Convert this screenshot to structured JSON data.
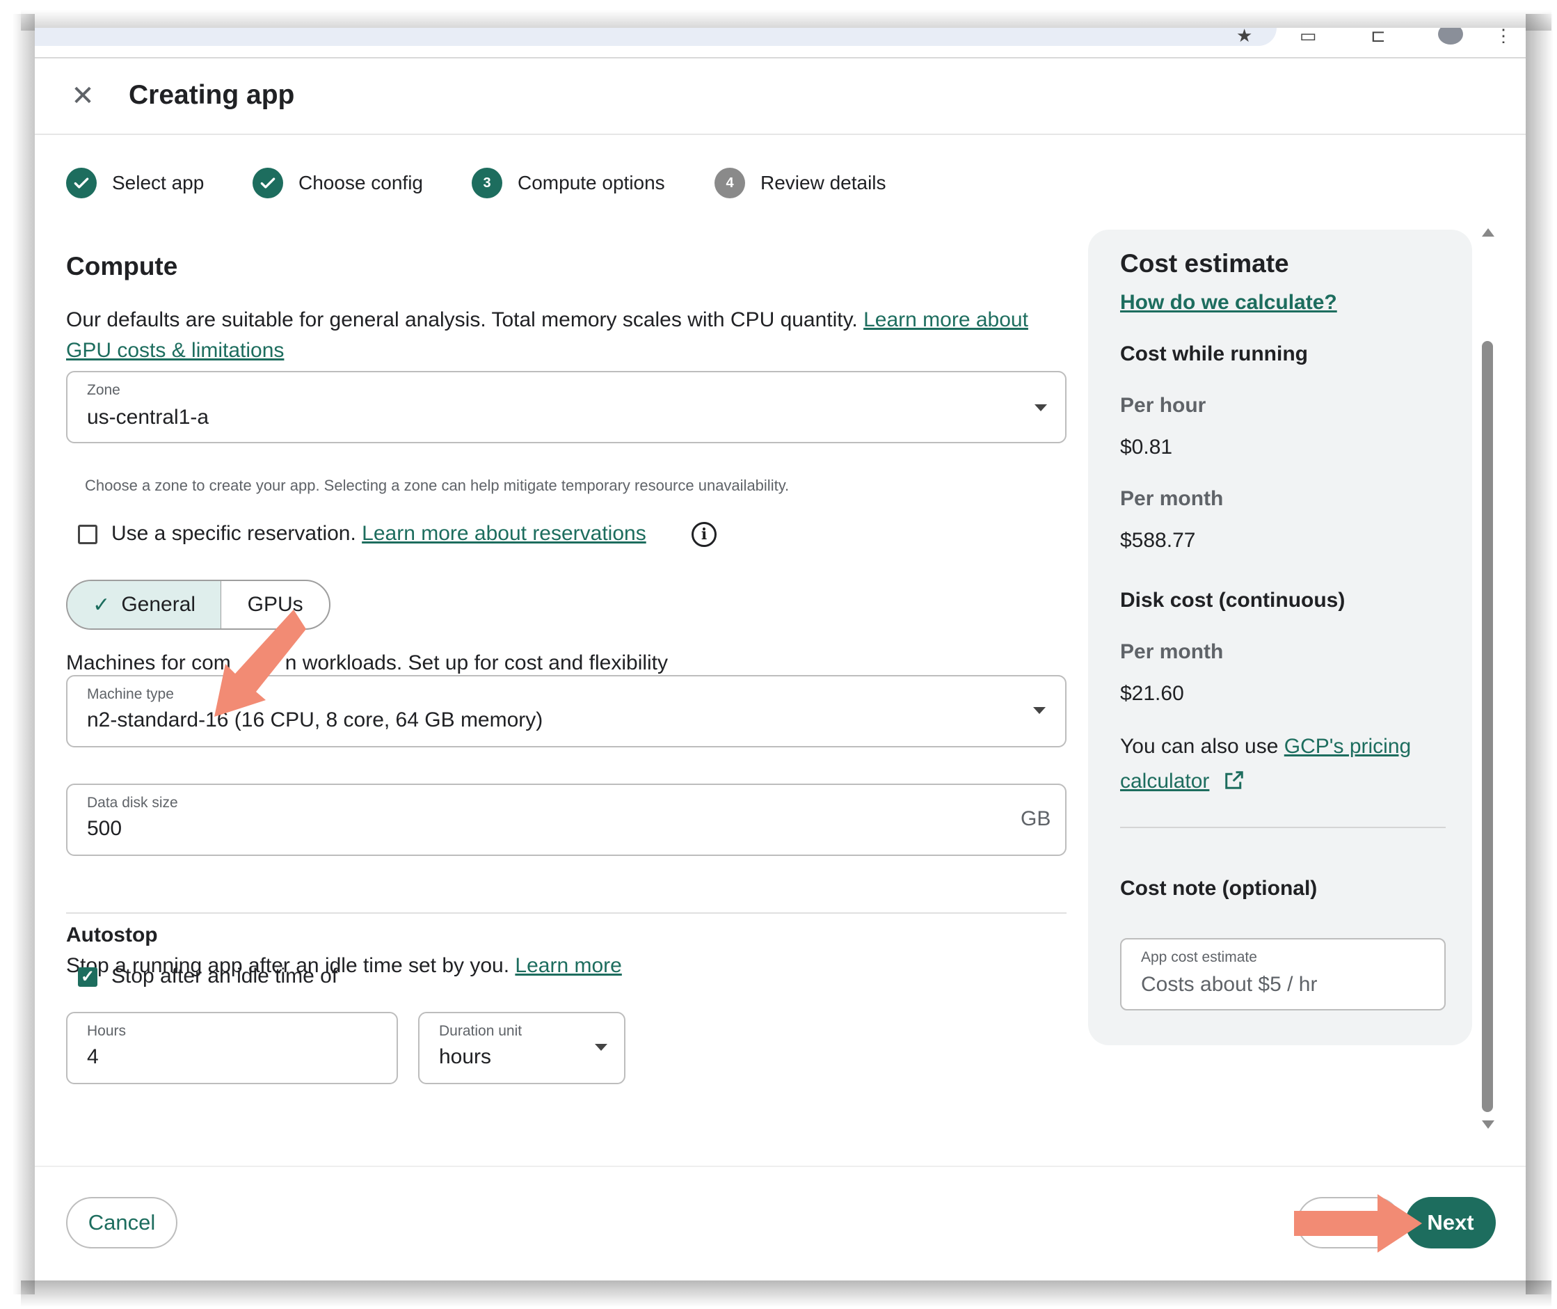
{
  "header": {
    "title": "Creating app"
  },
  "stepper": {
    "steps": [
      {
        "label": "Select app",
        "state": "done",
        "number": ""
      },
      {
        "label": "Choose config",
        "state": "done",
        "number": ""
      },
      {
        "label": "Compute options",
        "state": "current",
        "number": "3"
      },
      {
        "label": "Review details",
        "state": "pending",
        "number": "4"
      }
    ]
  },
  "compute": {
    "heading": "Compute",
    "description": "Our defaults are suitable for general analysis. Total memory scales with CPU quantity.",
    "description_link": "Learn more about GPU costs & limitations",
    "zone": {
      "label": "Zone",
      "value": "us-central1-a",
      "helper": "Choose a zone to create your app. Selecting a zone can help mitigate temporary resource unavailability."
    },
    "reservation": {
      "label": "Use a specific reservation.",
      "link": "Learn more about reservations",
      "checked": false
    },
    "segments": {
      "general": "General",
      "gpus": "GPUs",
      "selected": "General"
    },
    "machines_desc_a": "Machines for com",
    "machines_desc_b": "n workloads. Set up for cost and flexibility",
    "machine_type": {
      "label": "Machine type",
      "value": "n2-standard-16 (16 CPU, 8 core, 64 GB memory)"
    },
    "disk": {
      "label": "Data disk size",
      "value": "500",
      "unit": "GB"
    }
  },
  "autostop": {
    "heading": "Autostop",
    "description": "Stop a running app after an idle time set by you.",
    "link": "Learn more",
    "checkbox_label": "Stop after an idle time of",
    "checked": true,
    "hours": {
      "label": "Hours",
      "value": "4"
    },
    "duration_unit": {
      "label": "Duration unit",
      "value": "hours"
    }
  },
  "cost": {
    "title": "Cost estimate",
    "how_link": "How do we calculate?",
    "running_heading": "Cost while running",
    "per_hour_label": "Per hour",
    "per_hour_value": "$0.81",
    "per_month_label": "Per month",
    "per_month_value": "$588.77",
    "disk_heading": "Disk cost (continuous)",
    "disk_per_month_label": "Per month",
    "disk_per_month_value": "$21.60",
    "also_text": "You can also use",
    "also_link": "GCP's pricing calculator",
    "note_heading": "Cost note (optional)",
    "note_label": "App cost estimate",
    "note_placeholder": "Costs about $5 / hr"
  },
  "footer": {
    "cancel": "Cancel",
    "next": "Next"
  },
  "colors": {
    "accent": "#1d6d5e",
    "annotation": "#f28b74"
  }
}
